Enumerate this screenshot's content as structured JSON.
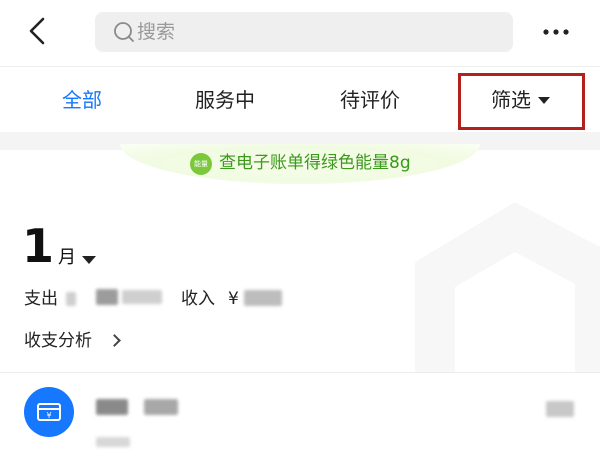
{
  "header": {
    "search_placeholder": "搜索",
    "icons": {
      "back": "back-icon",
      "search": "search-icon",
      "more": "more-icon"
    }
  },
  "tabs": [
    {
      "label": "全部",
      "active": true
    },
    {
      "label": "服务中",
      "active": false
    },
    {
      "label": "待评价",
      "active": false
    },
    {
      "label": "筛选",
      "active": false
    }
  ],
  "banner": {
    "badge": "能量",
    "text": "查电子账单得绿色能量8g"
  },
  "month": {
    "number": "1",
    "unit": "月"
  },
  "summary": {
    "expense_label": "支出",
    "income_label": "收入",
    "currency_symbol": "¥"
  },
  "analysis": {
    "label": "收支分析"
  },
  "list": {
    "items": [
      {
        "icon": "card-icon",
        "icon_glyph": "¥"
      }
    ]
  },
  "colors": {
    "accent": "#1677ff",
    "highlight_box": "#b3201d",
    "energy_green": "#3a9a1a"
  }
}
